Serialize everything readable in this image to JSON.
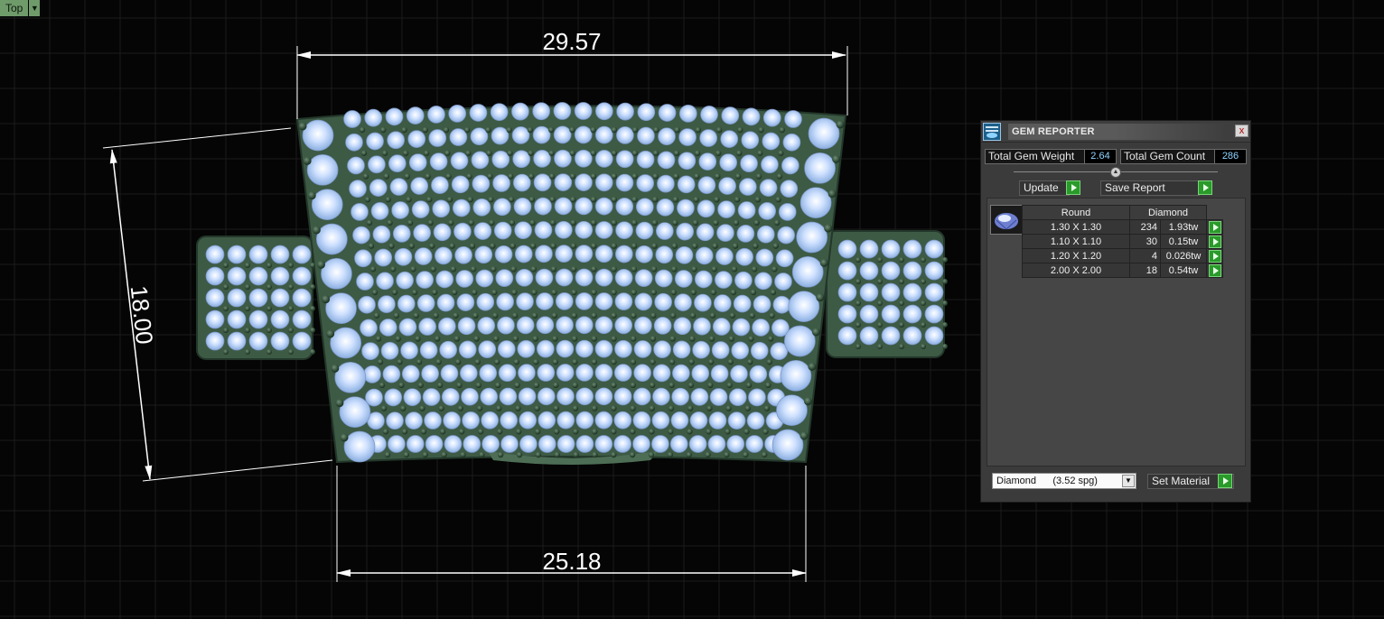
{
  "viewport": {
    "view_name": "Top",
    "dimensions": {
      "top_width": "29.57",
      "bottom_width": "25.18",
      "height": "18.00"
    }
  },
  "gem_reporter": {
    "title": "GEM REPORTER",
    "close_glyph": "x",
    "total_weight_label": "Total Gem Weight",
    "total_weight_value": "2.64",
    "total_count_label": "Total Gem Count",
    "total_count_value": "286",
    "update_label": "Update",
    "save_report_label": "Save Report",
    "table": {
      "shape_header": "Round",
      "material_header": "Diamond",
      "rows": [
        {
          "size": "1.30 X 1.30",
          "count": "234",
          "weight": "1.93tw"
        },
        {
          "size": "1.10 X 1.10",
          "count": "30",
          "weight": "0.15tw"
        },
        {
          "size": "1.20 X 1.20",
          "count": "4",
          "weight": "0.026tw"
        },
        {
          "size": "2.00 X 2.00",
          "count": "18",
          "weight": "0.54tw"
        }
      ]
    },
    "material_select": "Diamond      (3.52 spg)",
    "set_material_label": "Set Material"
  },
  "colors": {
    "background": "#050505",
    "grid": "#1c1c1c",
    "metal": "#3d5a45",
    "gem": "#b8d4ff",
    "prong": "#2c4a34",
    "accent_green": "#2a9a2a",
    "value_text": "#8fd4ff"
  },
  "icons": {
    "panel_icon": "gem-reporter-icon",
    "close": "close-icon",
    "play": "play-arrow-icon",
    "dropdown": "chevron-down-icon"
  }
}
